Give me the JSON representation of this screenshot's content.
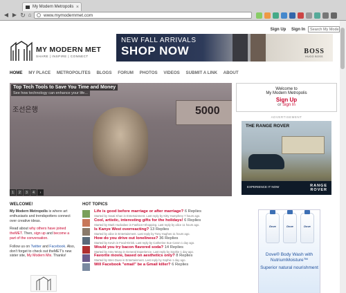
{
  "browser": {
    "tab_title": "My Modern Metropolis",
    "address": "www.mymodernmet.com"
  },
  "header": {
    "signup_link": "Sign Up",
    "signin_link": "Sign In",
    "search_placeholder": "Search My Modern",
    "logo_name": "MY MODERN MET",
    "logo_tagline": "SHARE | INSPIRE | CONNECT"
  },
  "banner": {
    "line1": "NEW FALL ARRIVALS",
    "line2": "SHOP NOW",
    "brand": "BOSS",
    "brand_sub": "HUGO BOSS"
  },
  "nav": {
    "items": [
      "HOME",
      "MY PLACE",
      "METROPOLITES",
      "BLOGS",
      "FORUM",
      "PHOTOS",
      "VIDEOS",
      "SUBMIT A LINK",
      "ABOUT"
    ]
  },
  "hero": {
    "title": "Top Tech Tools to Save You Time and Money",
    "subtitle": "See how technology can enhance your life...",
    "note_number": "5000",
    "note_text": "조선은행",
    "pages": [
      "1",
      "2",
      "3",
      "4",
      "›"
    ]
  },
  "welcome_box": {
    "line1": "Welcome to",
    "line2": "My Modern Metropolis",
    "signup": "Sign Up",
    "or": "or",
    "signin": "Sign In"
  },
  "ad": {
    "label": "ADVERTISEMENT",
    "title": "THE RANGE ROVER",
    "cta": "EXPERIENCE IT NOW",
    "brand_line1": "RANGE",
    "brand_line2": "ROVER"
  },
  "welcome": {
    "heading": "WELCOME!",
    "p1_bold": "My Modern Metropolis",
    "p1_rest": " is where art enthusiasts and trendspotters connect over creative ideas.",
    "p2_a": "Read about ",
    "p2_link1": "why others have joined theMET",
    "p2_b": ". Then, ",
    "p2_link2": "sign up",
    "p2_c": " and ",
    "p2_link3": "become a part of the conversation",
    "p2_d": ".",
    "p3_a": "Follow us on ",
    "p3_link1": "Twitter",
    "p3_b": " and ",
    "p3_link2": "Facebook",
    "p3_c": ". Also, don't forget to check out theMET's new sister site, ",
    "p3_link3": "My Modern Mix",
    "p3_d": ". Thanks!"
  },
  "topics": {
    "heading": "HOT TOPICS",
    "items": [
      {
        "title": "Life is good before marriage or after marriage?",
        "replies": "6 Replies",
        "meta": "Started by Swati Khan in Entertainment. Last reply by Kitty Humphrey 7 hours ago.",
        "color": "#7aa05a"
      },
      {
        "title": "Cool, artistic, interesting gifts for the holidays!",
        "replies": "6 Replies",
        "meta": "Started by Mark Huckabee in Fashion+Shopping. Last reply by alice 11 hours ago.",
        "color": "#c8785a"
      },
      {
        "title": "Is Kanye West overreacting?",
        "replies": "13 Replies",
        "meta": "Started by alice in Entertainment. Last reply by Tony Hughes 11 hours ago.",
        "color": "#8a7a6a"
      },
      {
        "title": "How do you drive out loneliness?",
        "replies": "36 Replies",
        "meta": "Started by Kevin in Food+Drink. Last reply by Catherine Sue Caron 1 day ago.",
        "color": "#5a6a7a"
      },
      {
        "title": "Would you try bacon flavored soda?",
        "replies": "14 Replies",
        "meta": "Started by Amy Wong in General Experience. Last reply by Sophie 1 day ago.",
        "color": "#b03030"
      },
      {
        "title": "Favorite movie, based on aesthetics only?",
        "replies": "8 Replies",
        "meta": "Started by Wen Duan in Entertainment. Last reply by Sophie 1 day ago.",
        "color": "#6a5a8a"
      },
      {
        "title": "Will Facebook \"email\" be a Gmail killer?",
        "replies": "6 Replies",
        "meta": "",
        "color": "#7a8aa0"
      }
    ]
  },
  "dove": {
    "bottle_label": "Dove",
    "line1": "Dove® Body Wash with NutriumMoisture™",
    "line2": "Superior natural nourishment"
  }
}
